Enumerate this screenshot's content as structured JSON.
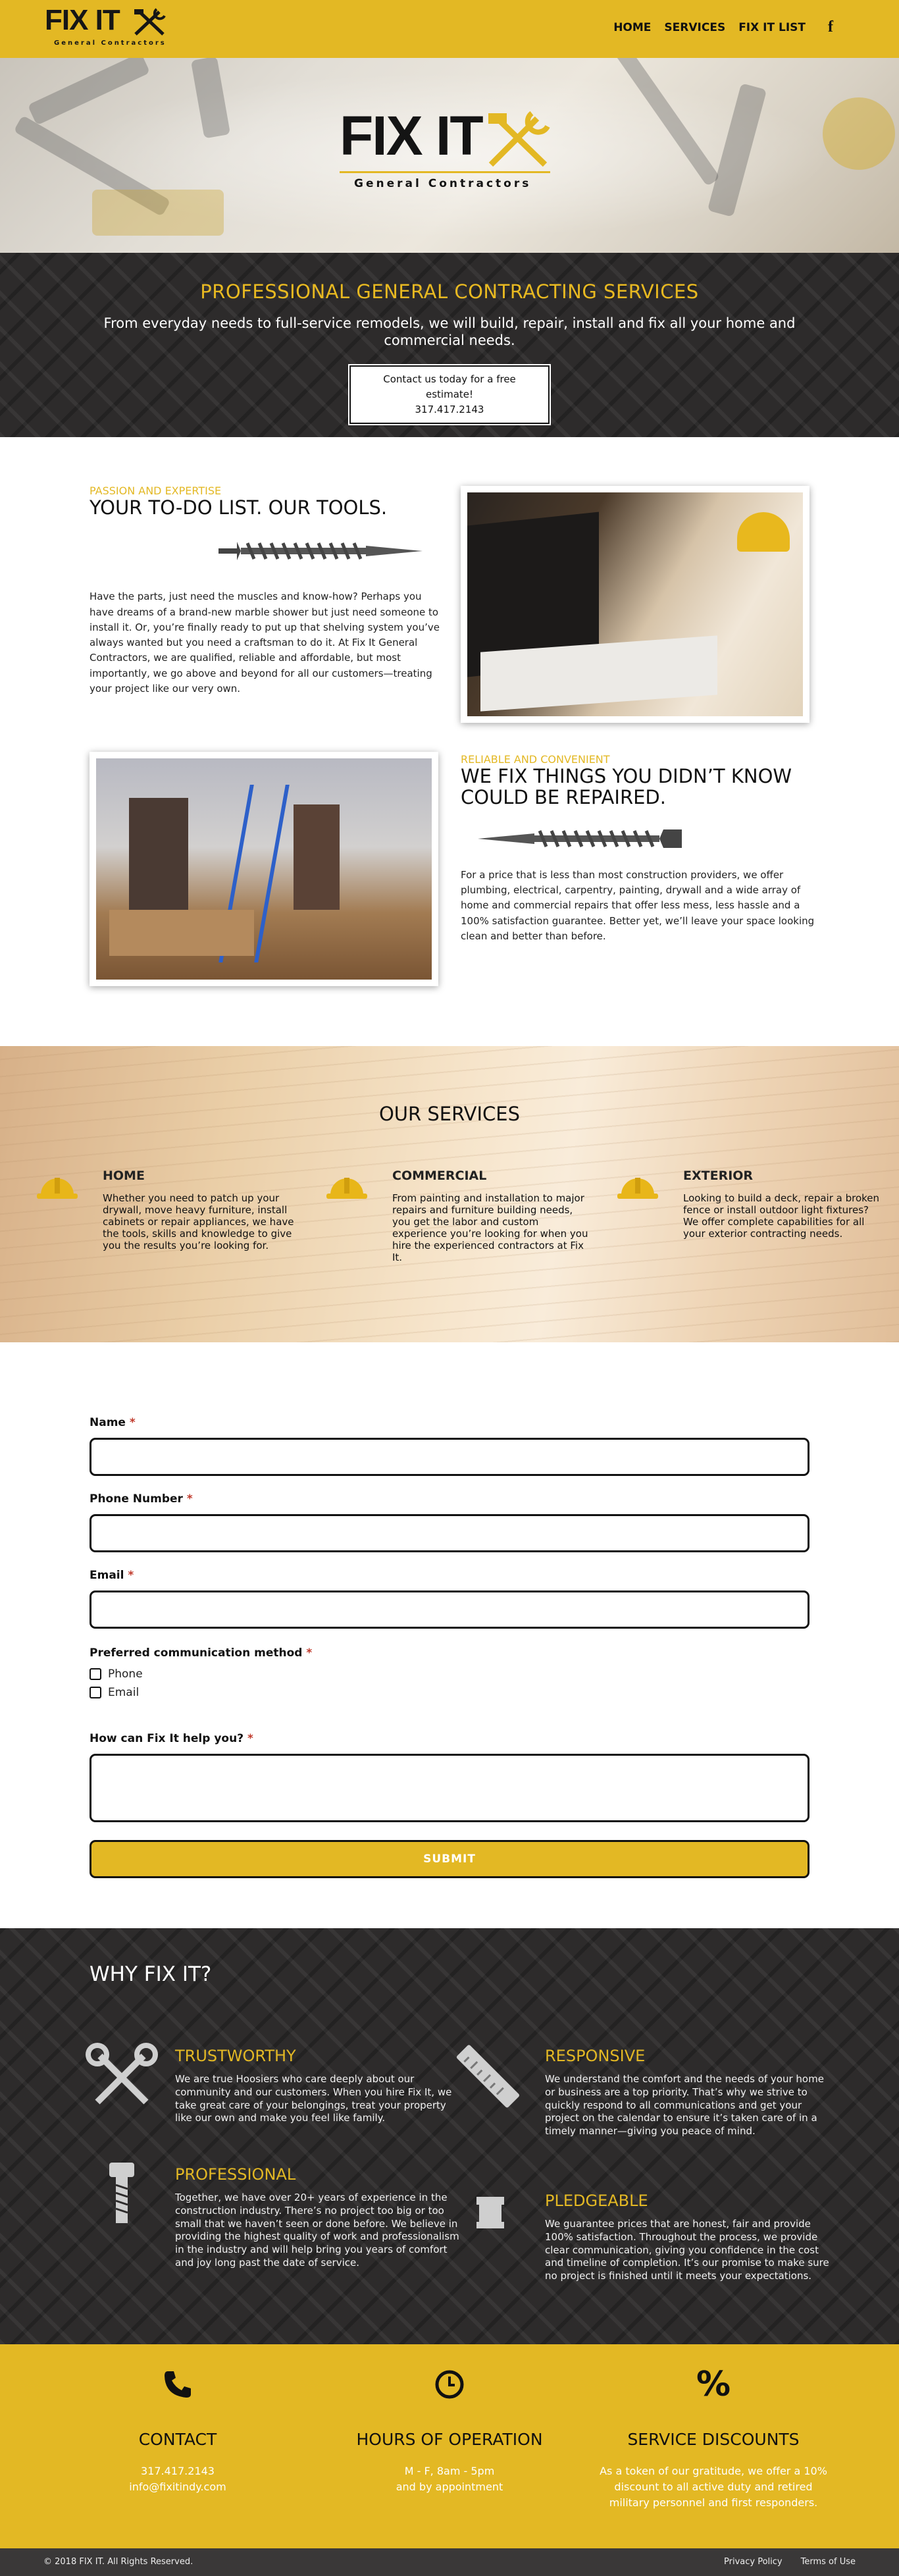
{
  "brand": {
    "logo_text": "FIX IT",
    "tagline": "General Contractors"
  },
  "nav": {
    "items": [
      "HOME",
      "SERVICES",
      "FIX IT LIST"
    ],
    "social_icon": "facebook-icon"
  },
  "banner": {
    "heading": "PROFESSIONAL GENERAL CONTRACTING SERVICES",
    "text": "From everyday needs to full-service remodels, we will build, repair, install and fix all your home and commercial needs.",
    "cta_line1": "Contact us today for a free estimate!",
    "cta_line2": "317.417.2143"
  },
  "about1": {
    "kicker": "PASSION AND EXPERTISE",
    "heading": "YOUR TO-DO LIST. OUR TOOLS.",
    "body": "Have the parts, just need the muscles and know-how? Perhaps you have dreams of a brand-new marble shower but just need someone to install it. Or, you’re finally ready to put up that shelving system you’ve always wanted but you need a craftsman to do it. At Fix It General Contractors, we are qualified, reliable and affordable, but most importantly, we go above and beyond for all our customers—treating your project like our very own."
  },
  "about2": {
    "kicker": "RELIABLE AND CONVENIENT",
    "heading": "WE FIX THINGS YOU DIDN’T KNOW COULD BE REPAIRED.",
    "body": "For a price that is less than most construction providers, we offer plumbing, electrical, carpentry, painting, drywall and a wide array of home and commercial repairs that offer less mess, less hassle and a 100% satisfaction guarantee. Better yet, we’ll leave your space looking clean and better than before."
  },
  "services": {
    "heading": "OUR SERVICES",
    "items": [
      {
        "title": "HOME",
        "text": "Whether you need to patch up your drywall, move heavy furniture, install cabinets or repair appliances, we have the tools, skills and knowledge to give you the results you’re looking for."
      },
      {
        "title": "COMMERCIAL",
        "text": "From painting and installation to major repairs and furniture building needs, you get the labor and custom experience you’re looking for when you hire the experienced contractors at Fix It."
      },
      {
        "title": "EXTERIOR",
        "text": "Looking to build a deck, repair a broken fence or install outdoor light fixtures? We offer complete capabilities for all your exterior contracting needs."
      }
    ]
  },
  "form": {
    "name_label": "Name",
    "phone_label": "Phone Number",
    "email_label": "Email",
    "method_label": "Preferred communication method",
    "options": [
      "Phone",
      "Email"
    ],
    "help_label": "How can Fix It help you?",
    "required_mark": "*",
    "submit": "SUBMIT"
  },
  "why": {
    "heading": "WHY FIX IT?",
    "items": [
      {
        "title": "TRUSTWORTHY",
        "text": "We are true Hoosiers who care deeply about our community and our customers. When you hire Fix It, we take great care of your belongings, treat your property like our own and make you feel like family."
      },
      {
        "title": "RESPONSIVE",
        "text": "We understand the comfort and the needs of your home or business are a top priority. That’s why we strive to quickly respond to all communications and get your project on the calendar to ensure it’s taken care of in a timely manner—giving you peace of mind."
      },
      {
        "title": "PROFESSIONAL",
        "text": "Together, we have over 20+ years of experience in the construction industry. There’s no project too big or too small that we haven’t seen or done before. We believe in providing the highest quality of work and professionalism in the industry and will help bring you years of comfort and joy long past the date of service."
      },
      {
        "title": "PLEDGEABLE",
        "text": "We guarantee prices that are honest, fair and provide 100% satisfaction. Throughout the process, we provide clear communication, giving you confidence in the cost and timeline of completion. It’s our promise to make sure no project is finished until it meets your expectations."
      }
    ]
  },
  "info": {
    "contact": {
      "title": "CONTACT",
      "phone": "317.417.2143",
      "email": "info@fixitindy.com"
    },
    "hours": {
      "title": "HOURS OF OPERATION",
      "line1": "M - F, 8am - 5pm",
      "line2": "and by appointment"
    },
    "discounts": {
      "title": "SERVICE DISCOUNTS",
      "text": "As a token of our gratitude, we offer a 10% discount to all active duty and retired military personnel and first responders."
    }
  },
  "footer": {
    "copyright": "© 2018 FIX IT. All Rights Reserved.",
    "links": [
      "Privacy Policy",
      "Terms of Use"
    ]
  },
  "colors": {
    "accent": "#e3b824",
    "dark": "#2d2b2b"
  }
}
